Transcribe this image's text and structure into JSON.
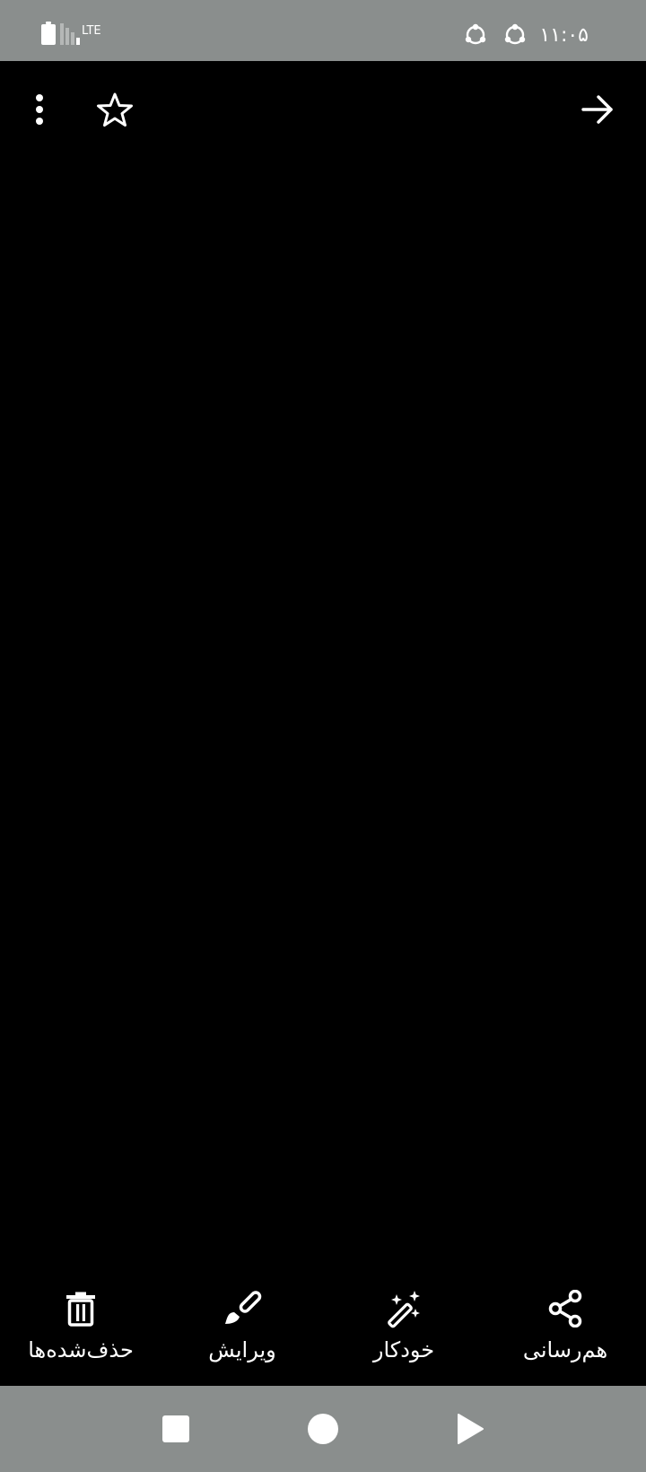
{
  "status_bar": {
    "time": "۱۱:۰۵",
    "network_label": "LTE",
    "background": "#8a8e8d"
  },
  "top_bar": {
    "icons": [
      "more-vert-icon",
      "star-outline-icon",
      "arrow-back-icon"
    ]
  },
  "actions": {
    "delete_label": "حذف‌شده‌ها",
    "edit_label": "ویرایش",
    "auto_label": "خودکار",
    "share_label": "هم‌رسانی"
  },
  "nav_bar": {
    "icons": [
      "recents-square-icon",
      "home-circle-icon",
      "back-triangle-icon"
    ]
  },
  "colors": {
    "foreground": "#ffffff",
    "background": "#000000",
    "system_bar": "#8a8e8d"
  }
}
